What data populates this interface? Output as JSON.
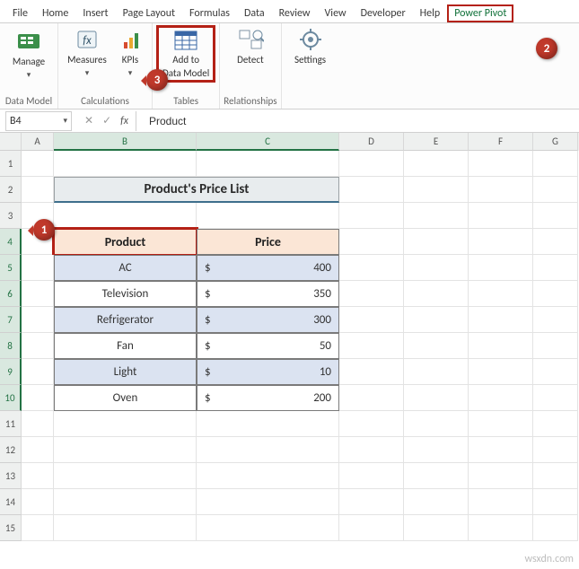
{
  "tabs": [
    "File",
    "Home",
    "Insert",
    "Page Layout",
    "Formulas",
    "Data",
    "Review",
    "View",
    "Developer",
    "Help",
    "Power Pivot"
  ],
  "ribbon": {
    "manage": "Manage",
    "measures": "Measures",
    "kpis": "KPIs",
    "addto": "Add to Data Model",
    "detect": "Detect",
    "settings": "Settings",
    "group_data_model": "Data Model",
    "group_calc": "Calculations",
    "group_tables": "Tables",
    "group_rel": "Relationships"
  },
  "cellref": "B4",
  "formula": "Product",
  "columns": [
    "",
    "A",
    "B",
    "C",
    "D",
    "E",
    "F",
    "G"
  ],
  "title": "Product's Price List",
  "table": {
    "head_product": "Product",
    "head_price": "Price",
    "rows": [
      {
        "product": "AC",
        "price": "400",
        "curr": "$"
      },
      {
        "product": "Television",
        "price": "350",
        "curr": "$"
      },
      {
        "product": "Refrigerator",
        "price": "300",
        "curr": "$"
      },
      {
        "product": "Fan",
        "price": "50",
        "curr": "$"
      },
      {
        "product": "Light",
        "price": "10",
        "curr": "$"
      },
      {
        "product": "Oven",
        "price": "200",
        "curr": "$"
      }
    ]
  },
  "watermark": "wsxdn.com",
  "callouts": {
    "c1": "1",
    "c2": "2",
    "c3": "3"
  },
  "chart_data": {
    "type": "table",
    "title": "Product's Price List",
    "columns": [
      "Product",
      "Price"
    ],
    "currency": "$",
    "rows": [
      [
        "AC",
        400
      ],
      [
        "Television",
        350
      ],
      [
        "Refrigerator",
        300
      ],
      [
        "Fan",
        50
      ],
      [
        "Light",
        10
      ],
      [
        "Oven",
        200
      ]
    ]
  }
}
